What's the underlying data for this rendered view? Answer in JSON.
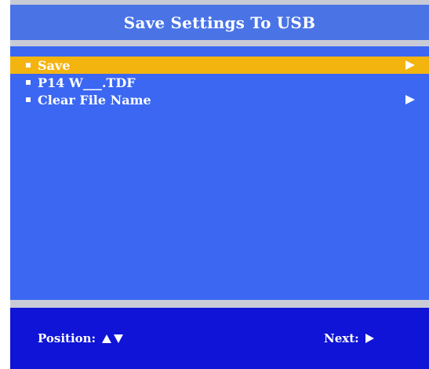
{
  "header": {
    "title": "Save Settings To USB"
  },
  "menu": {
    "items": [
      {
        "label": "Save",
        "selected": true,
        "has_arrow": true
      },
      {
        "label": "P14 W___.TDF",
        "selected": false,
        "has_arrow": false
      },
      {
        "label": "Clear File Name",
        "selected": false,
        "has_arrow": true
      }
    ]
  },
  "footer": {
    "position_label": "Position:",
    "next_label": "Next:"
  },
  "icons": {
    "bullet": "square-bullet-icon",
    "menu_arrow": "arrow-right-icon",
    "position_up": "arrow-up-icon",
    "position_down": "arrow-down-icon",
    "next": "arrow-right-icon"
  },
  "colors": {
    "title_bg": "#4a74e6",
    "panel_bg": "#3b67f3",
    "selected_bg": "#f4b410",
    "separator": "#c8cbd6",
    "footer_bg": "#0f14d6",
    "text": "#ffffff"
  }
}
